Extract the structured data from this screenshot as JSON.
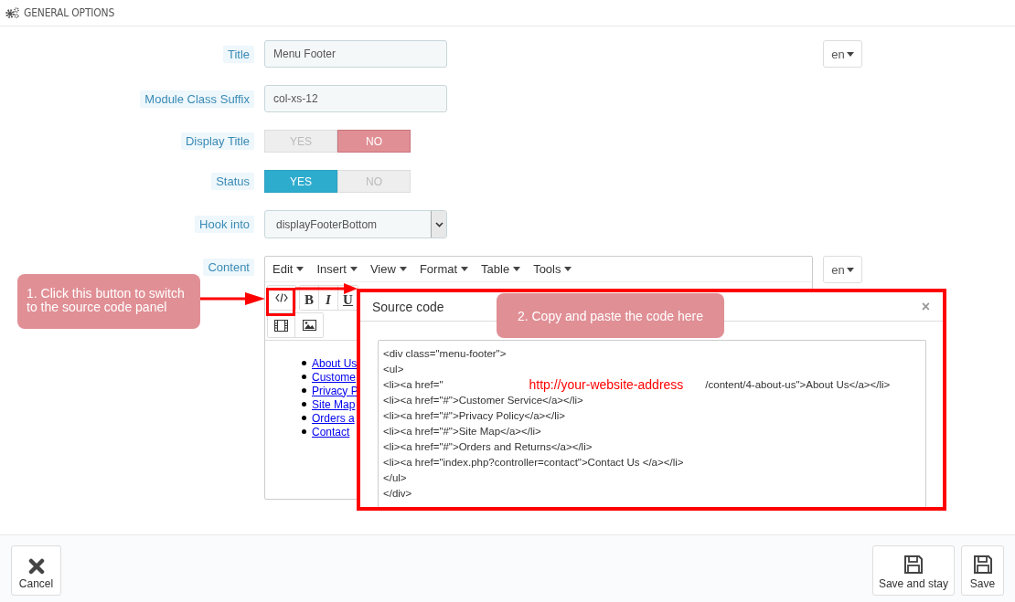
{
  "section": {
    "title": "GENERAL OPTIONS"
  },
  "fields": [
    {
      "kind": "text",
      "label": "Title",
      "value": "Menu Footer",
      "language": "en"
    },
    {
      "kind": "text",
      "label": "Module Class Suffix",
      "value": "col-xs-12"
    },
    {
      "kind": "switch",
      "label": "Display Title",
      "options": [
        {
          "label": "YES",
          "selected": false
        },
        {
          "label": "NO",
          "selected": true
        }
      ]
    },
    {
      "kind": "switch",
      "label": "Status",
      "options": [
        {
          "label": "YES",
          "selected": true
        },
        {
          "label": "NO",
          "selected": false
        }
      ]
    },
    {
      "kind": "select",
      "label": "Hook into",
      "value": "displayFooterBottom"
    },
    {
      "kind": "editor",
      "label": "Content",
      "language": "en"
    }
  ],
  "editor": {
    "menus": [
      "Edit",
      "Insert",
      "View",
      "Format",
      "Table",
      "Tools"
    ],
    "format_buttons": [
      "B",
      "I",
      "U"
    ],
    "links": [
      "About Us",
      "Custome",
      "Privacy P",
      "Site Map",
      "Orders a",
      "Contact"
    ]
  },
  "dialog": {
    "title": "Source code",
    "close": "×",
    "code_lines": [
      {
        "text": "<div class=\"menu-footer\">"
      },
      {
        "text": "<ul>"
      },
      {
        "text": "<li><a href=\"",
        "note": "http://your-website-address",
        "rest": "/content/4-about-us\">About Us</a></li>"
      },
      {
        "text": "<li><a href=\"#\">Customer Service</a></li>"
      },
      {
        "text": "<li><a href=\"#\">Privacy Policy</a></li>"
      },
      {
        "text": "<li><a href=\"#\">Site Map</a></li>"
      },
      {
        "text": "<li><a href=\"#\">Orders and Returns</a></li>"
      },
      {
        "text": "<li><a href=\"index.php?controller=contact\">Contact Us </a></li>"
      },
      {
        "text": "</ul>"
      },
      {
        "text": "</div>"
      }
    ]
  },
  "annotations": [
    {
      "text": "1. Click this button to switch to the source code panel"
    },
    {
      "text": "2. Copy and paste the code here"
    }
  ],
  "footer": {
    "buttons": [
      {
        "kind": "cancel",
        "label": "Cancel"
      },
      {
        "kind": "save",
        "label": "Save and stay"
      },
      {
        "kind": "save",
        "label": "Save"
      }
    ]
  }
}
